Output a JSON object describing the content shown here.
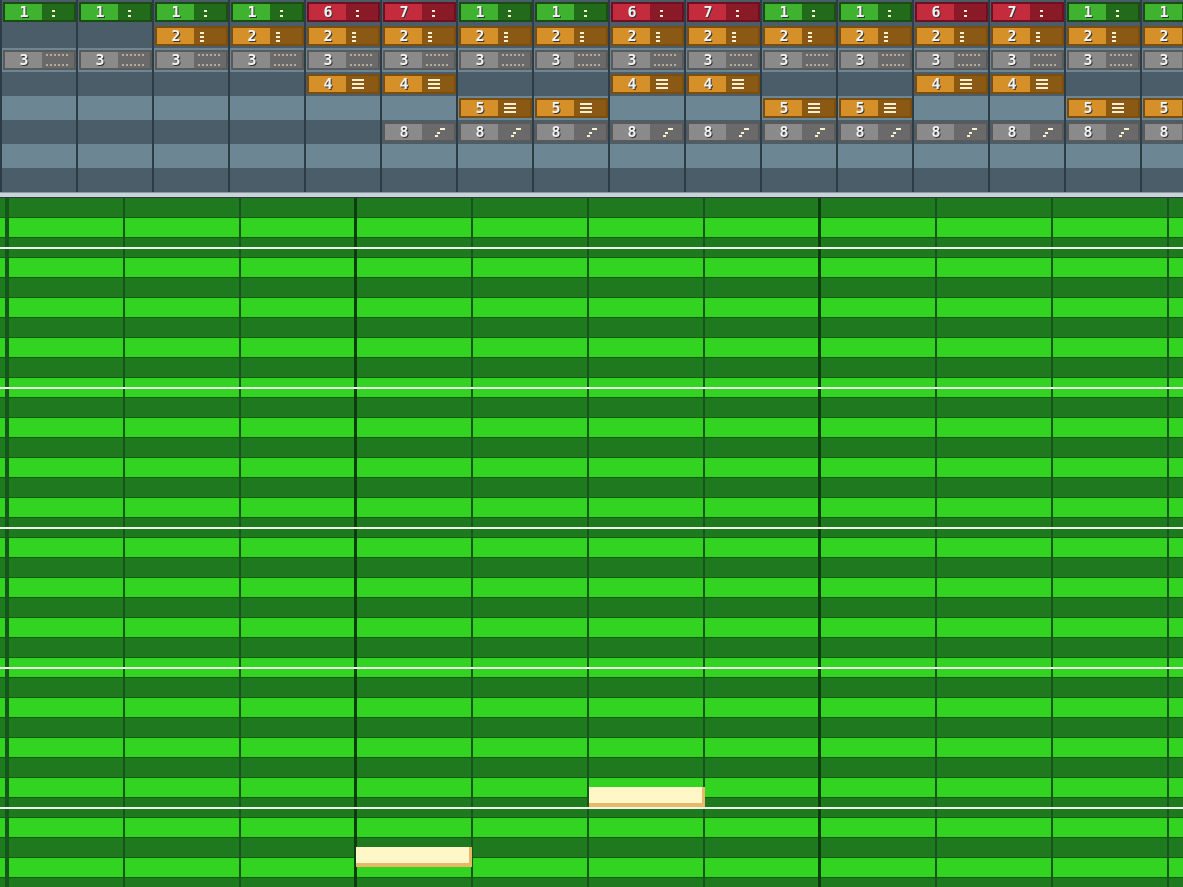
{
  "colors": {
    "green_pattern": "#3fb230",
    "red_pattern": "#c42b3c",
    "orange_pattern": "#d6902a",
    "gray_pattern": "#8a8a8a",
    "roll_bright": "#33d322",
    "roll_dark": "#1f7a1f",
    "note_fill": "#fff7c8"
  },
  "arranger": {
    "tracks": [
      {
        "name": "track-1",
        "cells": [
          "1",
          "1",
          "1",
          "1",
          "6",
          "7",
          "1",
          "1",
          "6",
          "7",
          "1",
          "1",
          "6",
          "7",
          "1",
          "1"
        ]
      },
      {
        "name": "track-2",
        "cells": [
          "",
          "",
          "2",
          "2",
          "2",
          "2",
          "2",
          "2",
          "2",
          "2",
          "2",
          "2",
          "2",
          "2",
          "2",
          "2"
        ]
      },
      {
        "name": "track-3",
        "cells": [
          "3",
          "3",
          "3",
          "3",
          "3",
          "3",
          "3",
          "3",
          "3",
          "3",
          "3",
          "3",
          "3",
          "3",
          "3",
          "3"
        ]
      },
      {
        "name": "track-4",
        "cells": [
          "",
          "",
          "",
          "",
          "4",
          "4",
          "",
          "",
          "4",
          "4",
          "",
          "",
          "4",
          "4",
          "",
          ""
        ]
      },
      {
        "name": "track-5",
        "cells": [
          "",
          "",
          "",
          "",
          "",
          "",
          "5",
          "5",
          "",
          "",
          "5",
          "5",
          "",
          "",
          "5",
          "5"
        ]
      },
      {
        "name": "track-6",
        "cells": [
          "",
          "",
          "",
          "",
          "",
          "8",
          "8",
          "8",
          "8",
          "8",
          "8",
          "8",
          "8",
          "8",
          "8",
          "8"
        ]
      },
      {
        "name": "track-7",
        "cells": []
      },
      {
        "name": "track-8",
        "cells": []
      }
    ],
    "pattern_colors": {
      "1": "green",
      "6": "red",
      "7": "red",
      "2": "orange",
      "4": "orange",
      "5": "orange",
      "3": "gray",
      "8": "gray"
    }
  },
  "piano_roll": {
    "notes": [
      {
        "row": 30,
        "step": 5,
        "length": 1
      },
      {
        "row": 33,
        "step": 3,
        "length": 1
      }
    ]
  }
}
